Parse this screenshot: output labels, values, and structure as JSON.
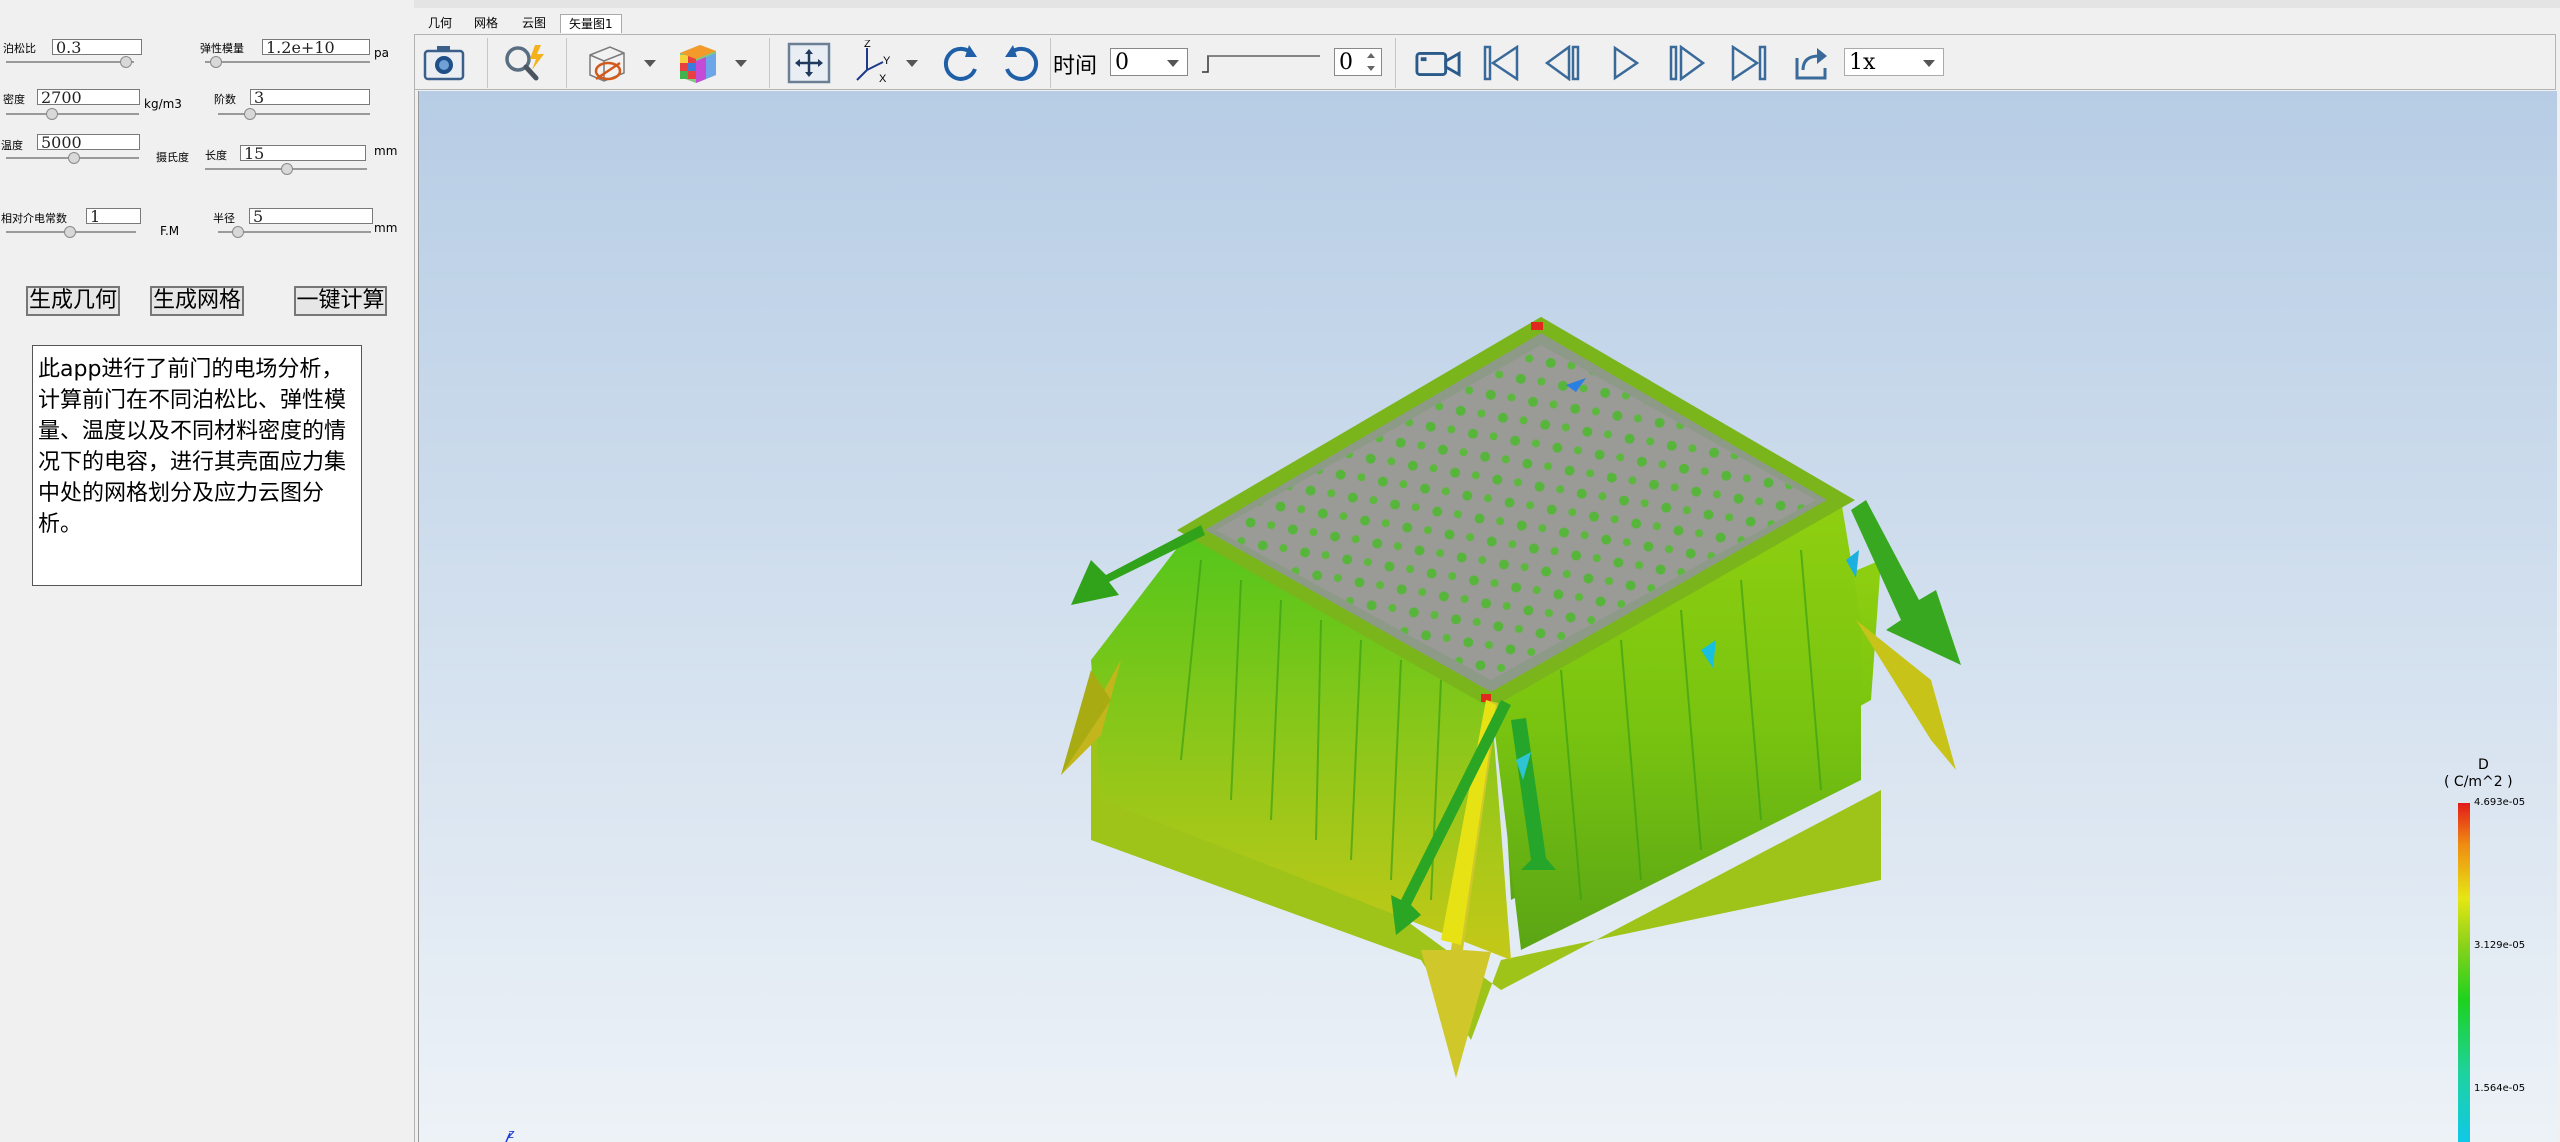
{
  "tabs": [
    {
      "label": "几何"
    },
    {
      "label": "网格"
    },
    {
      "label": "云图"
    },
    {
      "label": "矢量图1"
    }
  ],
  "params": {
    "poisson": {
      "label": "泊松比",
      "value": "0.3"
    },
    "modulus": {
      "label": "弹性模量",
      "value": "1.2e+10",
      "unit": "pa"
    },
    "density": {
      "label": "密度",
      "value": "2700",
      "unit": "kg/m3"
    },
    "order": {
      "label": "阶数",
      "value": "3"
    },
    "temperature": {
      "label": "温度",
      "value": "5000"
    },
    "celsius": {
      "label": "摄氏度"
    },
    "length": {
      "label": "长度",
      "value": "15",
      "unit": "mm"
    },
    "permittivity": {
      "label": "相对介电常数",
      "value": "1",
      "unit": "F.M"
    },
    "radius": {
      "label": "半径",
      "value": "5",
      "unit": "mm"
    }
  },
  "buttons": {
    "gen_geometry": "生成几何",
    "gen_mesh": "生成网格",
    "one_click": "一键计算"
  },
  "description": "此app进行了前门的电场分析，计算前门在不同泊松比、弹性模量、温度以及不同材料密度的情况下的电容，进行其壳面应力集中处的网格划分及应力云图分析。",
  "toolbar": {
    "time_label": "时间",
    "time_value": "0",
    "frame_value": "0",
    "speed_value": "1x",
    "axes": {
      "z": "Z",
      "y": "Y",
      "x": "X"
    }
  },
  "legend": {
    "title": "D",
    "unit": "( C/m^2 )",
    "max": "4.693e-05",
    "mid": "3.129e-05",
    "min": "1.564e-05"
  },
  "axis_indicator": "z",
  "colors": {
    "viewport_top": "#b7cde5",
    "viewport_bottom": "#edf2f7",
    "mesh_green": "#5fc21a",
    "arrow_yellow": "#c8c81a"
  }
}
